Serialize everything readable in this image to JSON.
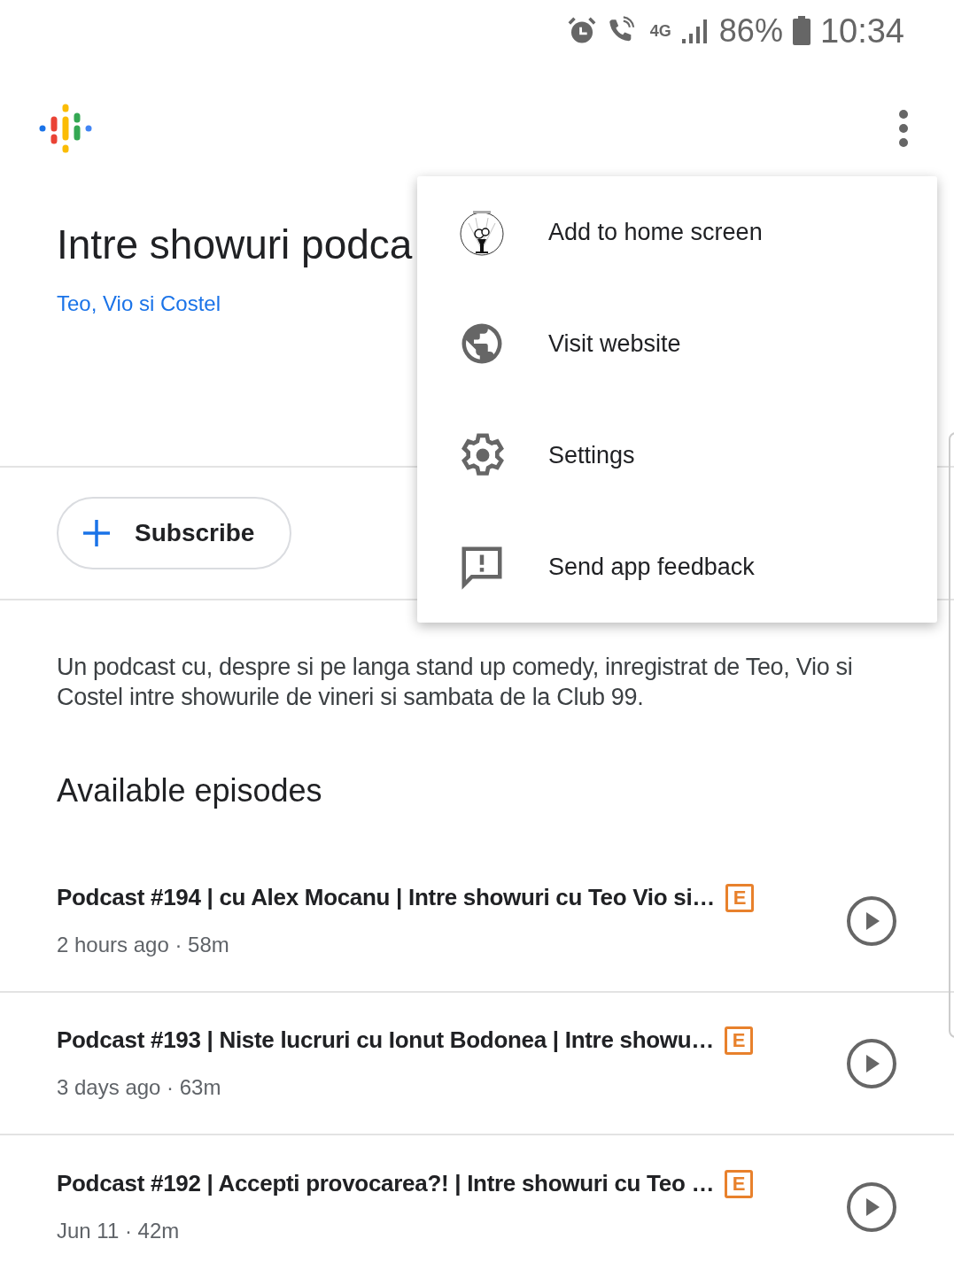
{
  "status_bar": {
    "network": "4G",
    "battery": "86%",
    "time": "10:34"
  },
  "podcast": {
    "title": "Intre showuri podca",
    "author": "Teo, Vio si Costel",
    "subscribe_label": "Subscribe",
    "description": "Un podcast cu, despre si pe langa stand up comedy, inregistrat de Teo, Vio si Costel intre showurile de vineri si sambata de la Club 99."
  },
  "menu": [
    {
      "kind": "picture",
      "label": "Add to home screen"
    },
    {
      "kind": "globe",
      "label": "Visit website"
    },
    {
      "kind": "gear",
      "label": "Settings"
    },
    {
      "kind": "feedback",
      "label": "Send app feedback"
    }
  ],
  "episodes_heading": "Available episodes",
  "episodes": [
    {
      "title": "Podcast #194 | cu Alex Mocanu | Intre showuri cu Teo Vio si…",
      "badge": "E",
      "meta": "2 hours ago · 58m"
    },
    {
      "title": "Podcast #193 | Niste lucruri cu Ionut Bodonea | Intre showu…",
      "badge": "E",
      "meta": "3 days ago · 63m"
    },
    {
      "title": "Podcast #192 | Accepti provocarea?! | Intre showuri cu Teo …",
      "badge": "E",
      "meta": "Jun 11 · 42m"
    }
  ]
}
